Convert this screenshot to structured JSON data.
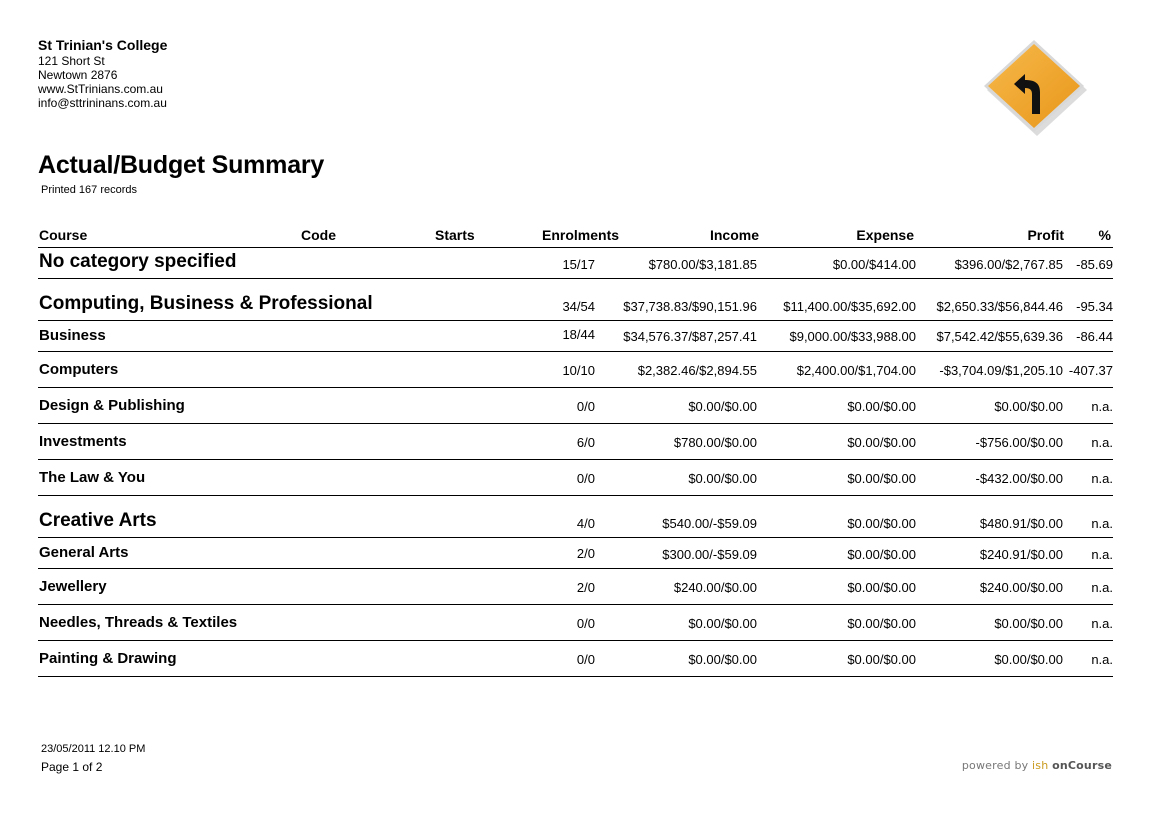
{
  "organisation": {
    "name": "St Trinian's College",
    "address_line1": "121 Short St",
    "address_line2": "Newtown 2876",
    "website": "www.StTrinians.com.au",
    "email": "info@sttrininans.com.au"
  },
  "logo": {
    "icon": "road-sign-curve-left-icon",
    "sign_color": "#f3a52c",
    "arrow_color": "#111111"
  },
  "report": {
    "title": "Actual/Budget Summary",
    "subtitle": "Printed 167 records"
  },
  "table": {
    "columns": {
      "course": "Course",
      "code": "Code",
      "starts": "Starts",
      "enrolments": "Enrolments",
      "income": "Income",
      "expense": "Expense",
      "profit": "Profit",
      "percent": "%"
    },
    "rows": [
      {
        "name": "No category specified",
        "enrolments": "15/17",
        "income": "$780.00/$3,181.85",
        "expense": "$0.00/$414.00",
        "profit": "$396.00/$2,767.85",
        "percent": "-85.69"
      },
      {
        "name": "Computing, Business & Professional",
        "enrolments": "34/54",
        "income": "$37,738.83/$90,151.96",
        "expense": "$11,400.00/$35,692.00",
        "profit": "$2,650.33/$56,844.46",
        "percent": "-95.34"
      },
      {
        "name": "Business",
        "enrolments": "18/44",
        "income": "$34,576.37/$87,257.41",
        "expense": "$9,000.00/$33,988.00",
        "profit": "$7,542.42/$55,639.36",
        "percent": "-86.44"
      },
      {
        "name": "Computers",
        "enrolments": "10/10",
        "income": "$2,382.46/$2,894.55",
        "expense": "$2,400.00/$1,704.00",
        "profit": "-$3,704.09/$1,205.10",
        "percent": "-407.37"
      },
      {
        "name": "Design & Publishing",
        "enrolments": "0/0",
        "income": "$0.00/$0.00",
        "expense": "$0.00/$0.00",
        "profit": "$0.00/$0.00",
        "percent": "n.a."
      },
      {
        "name": "Investments",
        "enrolments": "6/0",
        "income": "$780.00/$0.00",
        "expense": "$0.00/$0.00",
        "profit": "-$756.00/$0.00",
        "percent": "n.a."
      },
      {
        "name": "The Law & You",
        "enrolments": "0/0",
        "income": "$0.00/$0.00",
        "expense": "$0.00/$0.00",
        "profit": "-$432.00/$0.00",
        "percent": "n.a."
      },
      {
        "name": "Creative Arts",
        "enrolments": "4/0",
        "income": "$540.00/-$59.09",
        "expense": "$0.00/$0.00",
        "profit": "$480.91/$0.00",
        "percent": "n.a."
      },
      {
        "name": "General Arts",
        "enrolments": "2/0",
        "income": "$300.00/-$59.09",
        "expense": "$0.00/$0.00",
        "profit": "$240.91/$0.00",
        "percent": "n.a."
      },
      {
        "name": "Jewellery",
        "enrolments": "2/0",
        "income": "$240.00/$0.00",
        "expense": "$0.00/$0.00",
        "profit": "$240.00/$0.00",
        "percent": "n.a."
      },
      {
        "name": "Needles, Threads & Textiles",
        "enrolments": "0/0",
        "income": "$0.00/$0.00",
        "expense": "$0.00/$0.00",
        "profit": "$0.00/$0.00",
        "percent": "n.a."
      },
      {
        "name": "Painting & Drawing",
        "enrolments": "0/0",
        "income": "$0.00/$0.00",
        "expense": "$0.00/$0.00",
        "profit": "$0.00/$0.00",
        "percent": "n.a."
      }
    ]
  },
  "footer": {
    "printed_at": "23/05/2011 12.10 PM",
    "page": "Page 1 of 2",
    "powered_prefix": "powered by",
    "powered_ish": "ish",
    "powered_product": "onCourse"
  }
}
